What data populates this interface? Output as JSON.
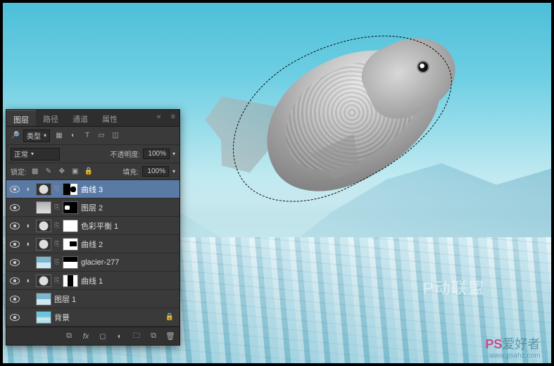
{
  "tabs": {
    "layers": "图层",
    "paths": "路径",
    "channels": "通道",
    "properties": "属性"
  },
  "filter_label": "类型",
  "blend_mode": "正常",
  "opacity_label": "不透明度:",
  "opacity_value": "100%",
  "lock_label": "锁定:",
  "fill_label": "填充:",
  "fill_value": "100%",
  "layers": [
    {
      "name": "曲线 3",
      "type": "adj",
      "mask": "m1",
      "selected": true
    },
    {
      "name": "图层 2",
      "type": "img2",
      "mask": "m2"
    },
    {
      "name": "色彩平衡 1",
      "type": "adj",
      "mask": "white"
    },
    {
      "name": "曲线 2",
      "type": "adj",
      "mask": "m4"
    },
    {
      "name": "glacier-277",
      "type": "img1",
      "mask": "m5"
    },
    {
      "name": "曲线 1",
      "type": "adj",
      "mask": "m3"
    },
    {
      "name": "图层 1",
      "type": "img1",
      "mask": null
    },
    {
      "name": "背景",
      "type": "bg",
      "mask": null,
      "locked": true
    }
  ],
  "watermarks": {
    "center": "P动联盟",
    "brand_prefix": "PS",
    "brand_suffix": "爱好者",
    "url": "www.psahz.com"
  }
}
